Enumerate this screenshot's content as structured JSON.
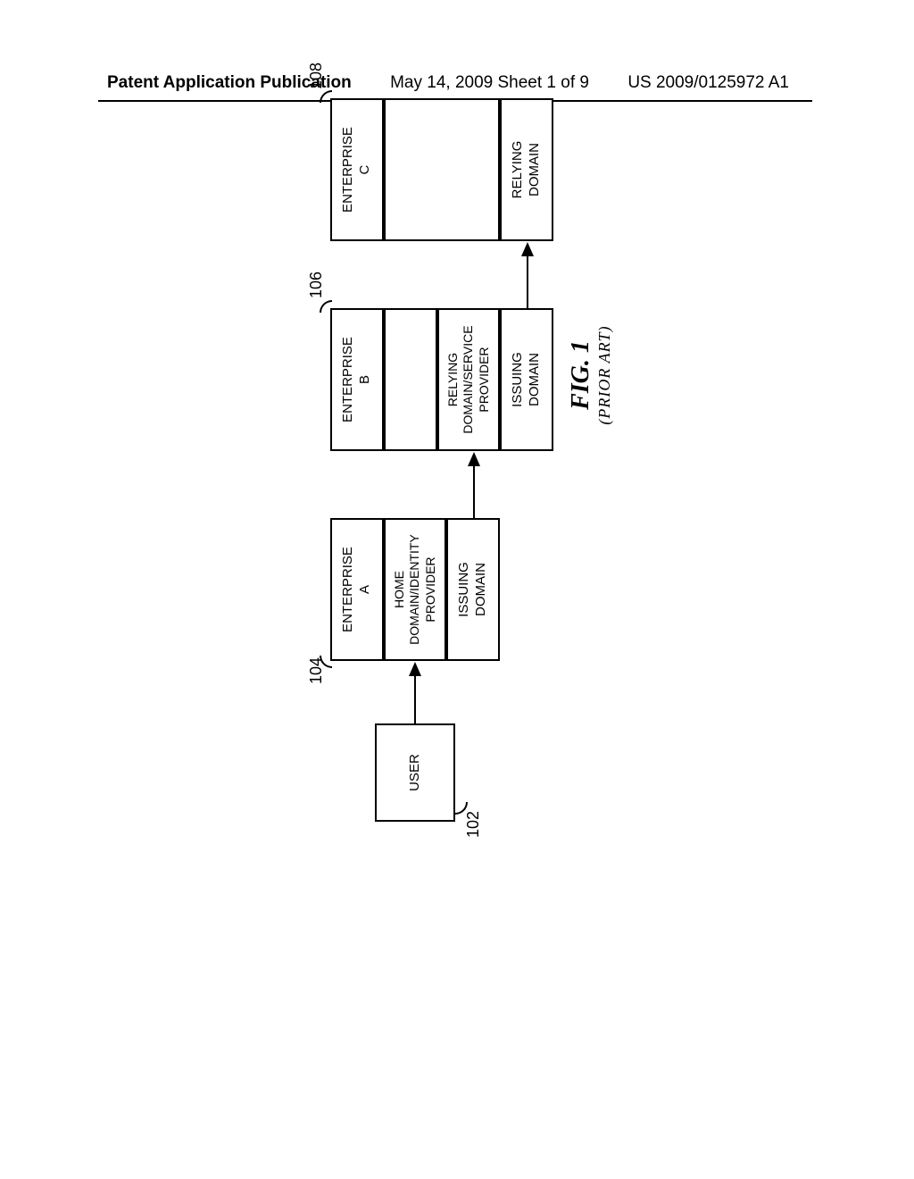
{
  "header": {
    "pub": "Patent Application Publication",
    "date": "May 14, 2009  Sheet 1 of 9",
    "doc": "US 2009/0125972 A1"
  },
  "labels": {
    "l102": "102",
    "l104": "104",
    "l106": "106",
    "l108": "108"
  },
  "boxes": {
    "user": "USER",
    "entA": "ENTERPRISE\nA",
    "entA_home": "HOME\nDOMAIN/IDENTITY\nPROVIDER",
    "entA_issuing": "ISSUING\nDOMAIN",
    "entB": "ENTERPRISE\nB",
    "entB_rely": "RELYING\nDOMAIN/SERVICE\nPROVIDER",
    "entB_issuing": "ISSUING\nDOMAIN",
    "entC": "ENTERPRISE\nC",
    "entC_rely": "RELYING\nDOMAIN"
  },
  "figure": {
    "fig": "FIG. 1",
    "prior": "(PRIOR ART)"
  }
}
